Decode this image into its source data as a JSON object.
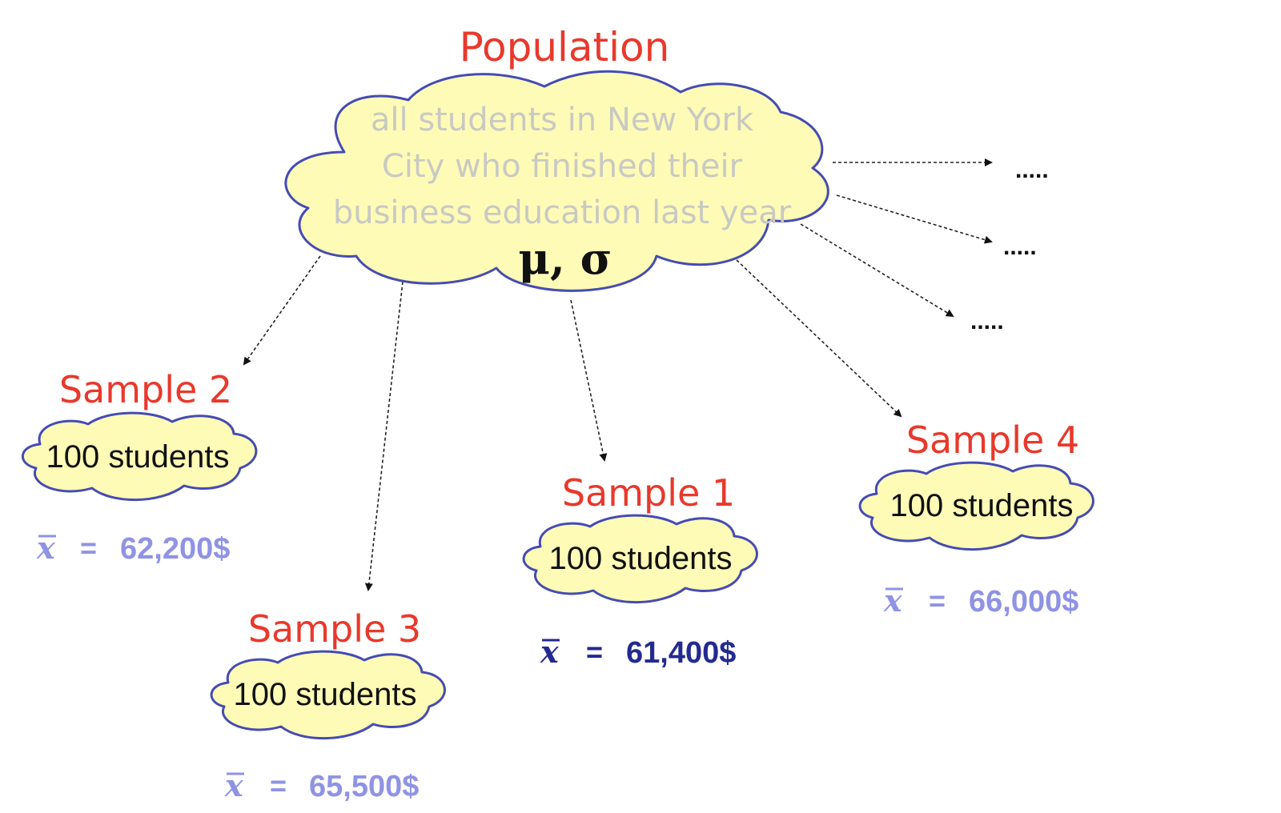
{
  "population": {
    "title": "Population",
    "description_lines": [
      "all students in New York",
      "City who finished their",
      "business education last year"
    ],
    "parameters": "μ, σ"
  },
  "samples": [
    {
      "title": "Sample 2",
      "size_label": "100 students",
      "mean_symbol": "x",
      "equals": "=",
      "mean_value": "62,200$",
      "mean_color": "#8f93e4"
    },
    {
      "title": "Sample 3",
      "size_label": "100 students",
      "mean_symbol": "x",
      "equals": "=",
      "mean_value": "65,500$",
      "mean_color": "#8f93e4"
    },
    {
      "title": "Sample 1",
      "size_label": "100 students",
      "mean_symbol": "x",
      "equals": "=",
      "mean_value": "61,400$",
      "mean_color": "#232a8f"
    },
    {
      "title": "Sample 4",
      "size_label": "100 students",
      "mean_symbol": "x",
      "equals": "=",
      "mean_value": "66,000$",
      "mean_color": "#8f93e4"
    }
  ],
  "continuation_markers": [
    ".....",
    ".....",
    "....."
  ],
  "colors": {
    "title_red": "#e8392c",
    "cloud_fill": "#fefbb7",
    "cloud_outline": "#454cb2",
    "population_text": "#c9c9c3"
  }
}
